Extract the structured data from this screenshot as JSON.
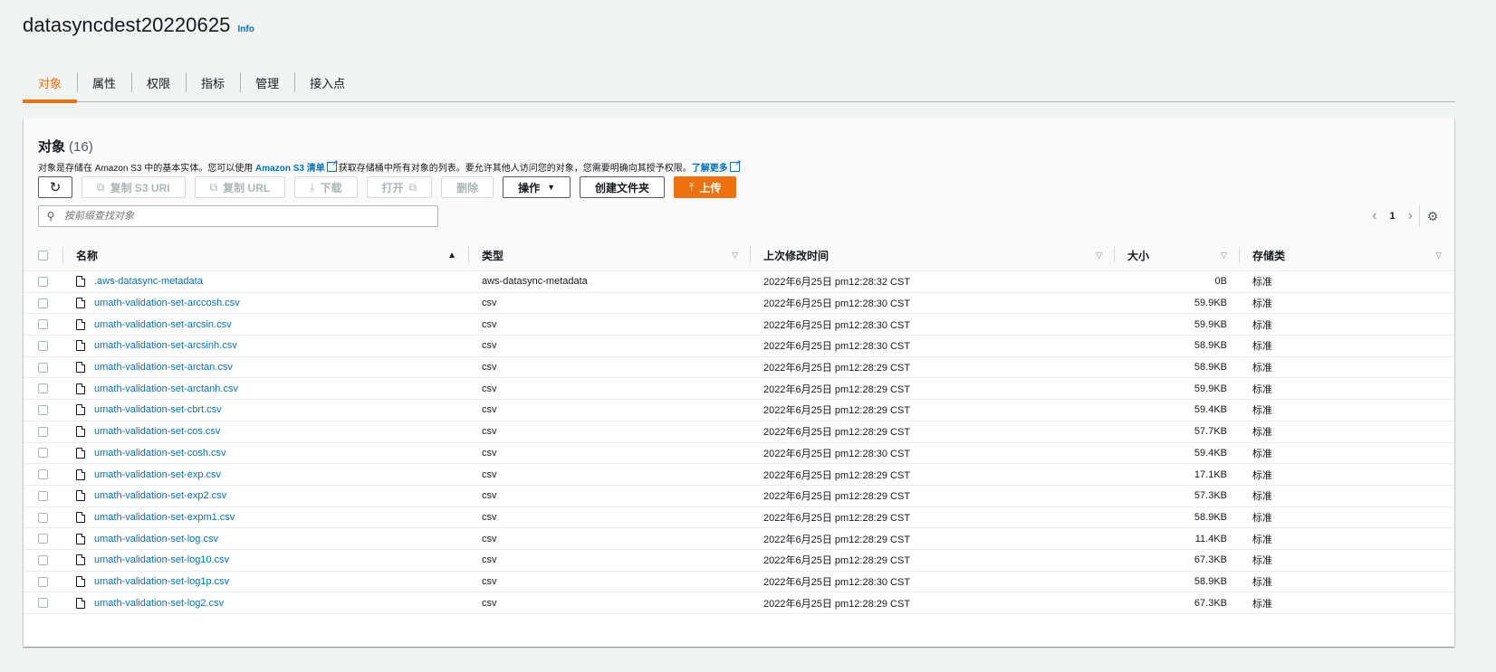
{
  "header": {
    "title": "datasyncdest20220625",
    "info": "Info"
  },
  "tabs": [
    "对象",
    "属性",
    "权限",
    "指标",
    "管理",
    "接入点"
  ],
  "panel": {
    "title": "对象",
    "count": "(16)",
    "description": {
      "part1": "对象是存储在 Amazon S3 中的基本实体。您可以使用 ",
      "link1": "Amazon S3 清单",
      "part2": "获取存储桶中所有对象的列表。要允许其他人访问您的对象，您需要明确向其授予权限。",
      "link2": "了解更多"
    }
  },
  "toolbar": {
    "copy_s3_uri": "复制 S3 URI",
    "copy_url": "复制 URL",
    "download": "下载",
    "open": "打开",
    "delete": "删除",
    "actions": "操作",
    "create_folder": "创建文件夹",
    "upload": "上传"
  },
  "search": {
    "placeholder": "按前缀查找对象"
  },
  "pager": {
    "page": "1"
  },
  "table": {
    "columns": {
      "name": "名称",
      "type": "类型",
      "modified": "上次修改时间",
      "size": "大小",
      "storage": "存储类"
    },
    "rows": [
      {
        "name": ".aws-datasync-metadata",
        "type": "aws-datasync-metadata",
        "modified": "2022年6月25日 pm12:28:32 CST",
        "size": "0B",
        "storage": "标准"
      },
      {
        "name": "umath-validation-set-arccosh.csv",
        "type": "csv",
        "modified": "2022年6月25日 pm12:28:30 CST",
        "size": "59.9KB",
        "storage": "标准"
      },
      {
        "name": "umath-validation-set-arcsin.csv",
        "type": "csv",
        "modified": "2022年6月25日 pm12:28:30 CST",
        "size": "59.9KB",
        "storage": "标准"
      },
      {
        "name": "umath-validation-set-arcsinh.csv",
        "type": "csv",
        "modified": "2022年6月25日 pm12:28:30 CST",
        "size": "58.9KB",
        "storage": "标准"
      },
      {
        "name": "umath-validation-set-arctan.csv",
        "type": "csv",
        "modified": "2022年6月25日 pm12:28:29 CST",
        "size": "58.9KB",
        "storage": "标准"
      },
      {
        "name": "umath-validation-set-arctanh.csv",
        "type": "csv",
        "modified": "2022年6月25日 pm12:28:29 CST",
        "size": "59.9KB",
        "storage": "标准"
      },
      {
        "name": "umath-validation-set-cbrt.csv",
        "type": "csv",
        "modified": "2022年6月25日 pm12:28:29 CST",
        "size": "59.4KB",
        "storage": "标准"
      },
      {
        "name": "umath-validation-set-cos.csv",
        "type": "csv",
        "modified": "2022年6月25日 pm12:28:29 CST",
        "size": "57.7KB",
        "storage": "标准"
      },
      {
        "name": "umath-validation-set-cosh.csv",
        "type": "csv",
        "modified": "2022年6月25日 pm12:28:30 CST",
        "size": "59.4KB",
        "storage": "标准"
      },
      {
        "name": "umath-validation-set-exp.csv",
        "type": "csv",
        "modified": "2022年6月25日 pm12:28:29 CST",
        "size": "17.1KB",
        "storage": "标准"
      },
      {
        "name": "umath-validation-set-exp2.csv",
        "type": "csv",
        "modified": "2022年6月25日 pm12:28:29 CST",
        "size": "57.3KB",
        "storage": "标准"
      },
      {
        "name": "umath-validation-set-expm1.csv",
        "type": "csv",
        "modified": "2022年6月25日 pm12:28:29 CST",
        "size": "58.9KB",
        "storage": "标准"
      },
      {
        "name": "umath-validation-set-log.csv",
        "type": "csv",
        "modified": "2022年6月25日 pm12:28:29 CST",
        "size": "11.4KB",
        "storage": "标准"
      },
      {
        "name": "umath-validation-set-log10.csv",
        "type": "csv",
        "modified": "2022年6月25日 pm12:28:29 CST",
        "size": "67.3KB",
        "storage": "标准"
      },
      {
        "name": "umath-validation-set-log1p.csv",
        "type": "csv",
        "modified": "2022年6月25日 pm12:28:30 CST",
        "size": "58.9KB",
        "storage": "标准"
      },
      {
        "name": "umath-validation-set-log2.csv",
        "type": "csv",
        "modified": "2022年6月25日 pm12:28:29 CST",
        "size": "67.3KB",
        "storage": "标准"
      }
    ]
  }
}
